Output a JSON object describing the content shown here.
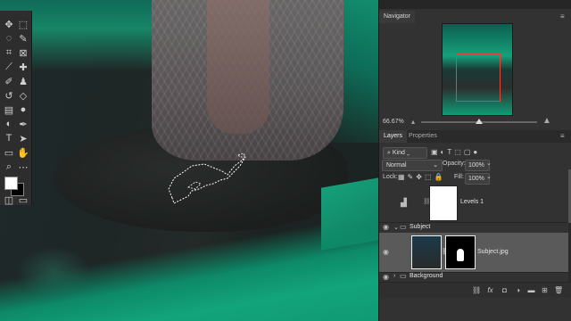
{
  "navigator": {
    "title": "Navigator",
    "zoom": "66.67%"
  },
  "layers_panel": {
    "tabs": [
      "Layers",
      "Properties"
    ],
    "filter_label": "Kind",
    "blend_mode": "Normal",
    "opacity_label": "Opacity:",
    "opacity_value": "100%",
    "lock_label": "Lock:",
    "fill_label": "Fill:",
    "fill_value": "100%",
    "layers": [
      {
        "name": "Levels 1",
        "visible": false
      },
      {
        "name": "Subject",
        "visible": true
      },
      {
        "name": "Subject.jpg",
        "visible": true
      },
      {
        "name": "Background",
        "visible": true
      }
    ]
  },
  "colors": {
    "accent_red": "#e0463b",
    "water": "#12a47b",
    "panel": "#323232"
  }
}
